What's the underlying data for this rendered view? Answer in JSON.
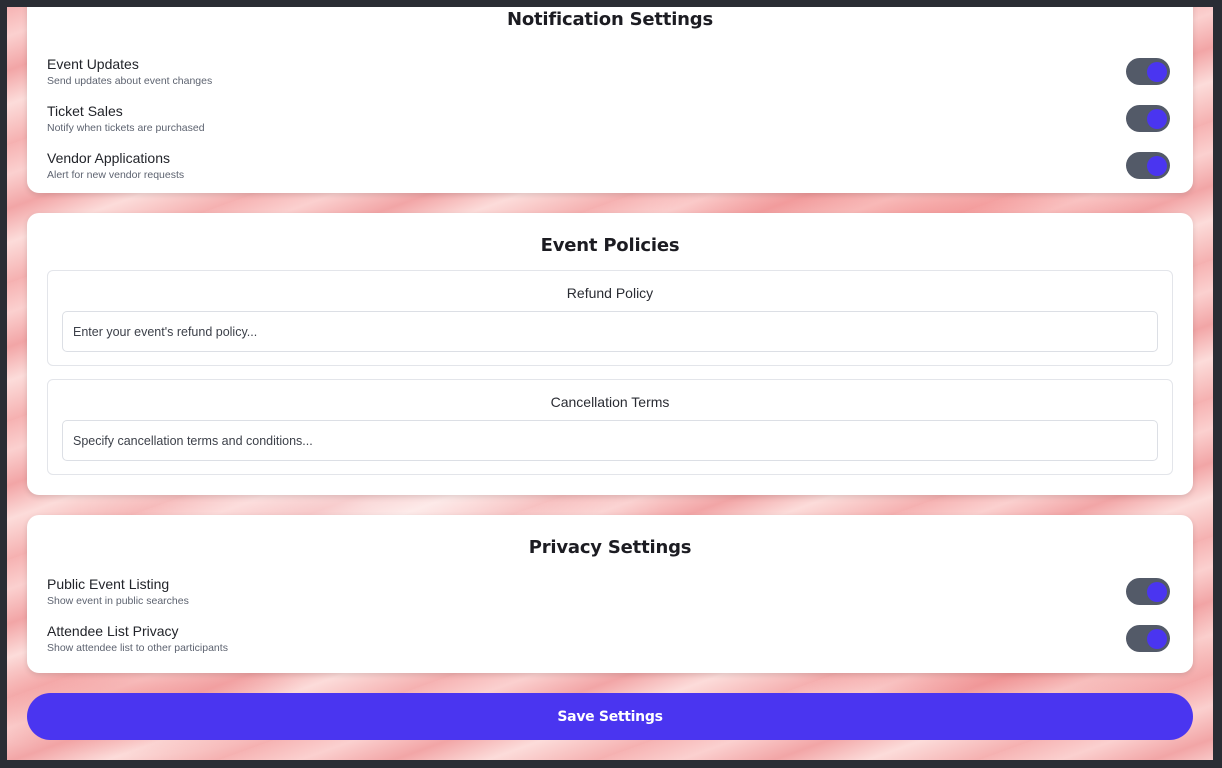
{
  "notifications": {
    "title": "Notification Settings",
    "items": [
      {
        "label": "Event Updates",
        "description": "Send updates about event changes",
        "enabled": true
      },
      {
        "label": "Ticket Sales",
        "description": "Notify when tickets are purchased",
        "enabled": true
      },
      {
        "label": "Vendor Applications",
        "description": "Alert for new vendor requests",
        "enabled": true
      }
    ]
  },
  "policies": {
    "title": "Event Policies",
    "refund": {
      "label": "Refund Policy",
      "placeholder": "Enter your event's refund policy...",
      "value": ""
    },
    "cancellation": {
      "label": "Cancellation Terms",
      "placeholder": "Specify cancellation terms and conditions...",
      "value": ""
    }
  },
  "privacy": {
    "title": "Privacy Settings",
    "items": [
      {
        "label": "Public Event Listing",
        "description": "Show event in public searches",
        "enabled": true
      },
      {
        "label": "Attendee List Privacy",
        "description": "Show attendee list to other participants",
        "enabled": true
      }
    ]
  },
  "save_button": {
    "label": "Save Settings"
  },
  "colors": {
    "accent": "#4a35f0",
    "toggle_track": "#535a68",
    "card": "#ffffff"
  },
  "icons": {
    "toggle": "toggle-switch-icon"
  }
}
